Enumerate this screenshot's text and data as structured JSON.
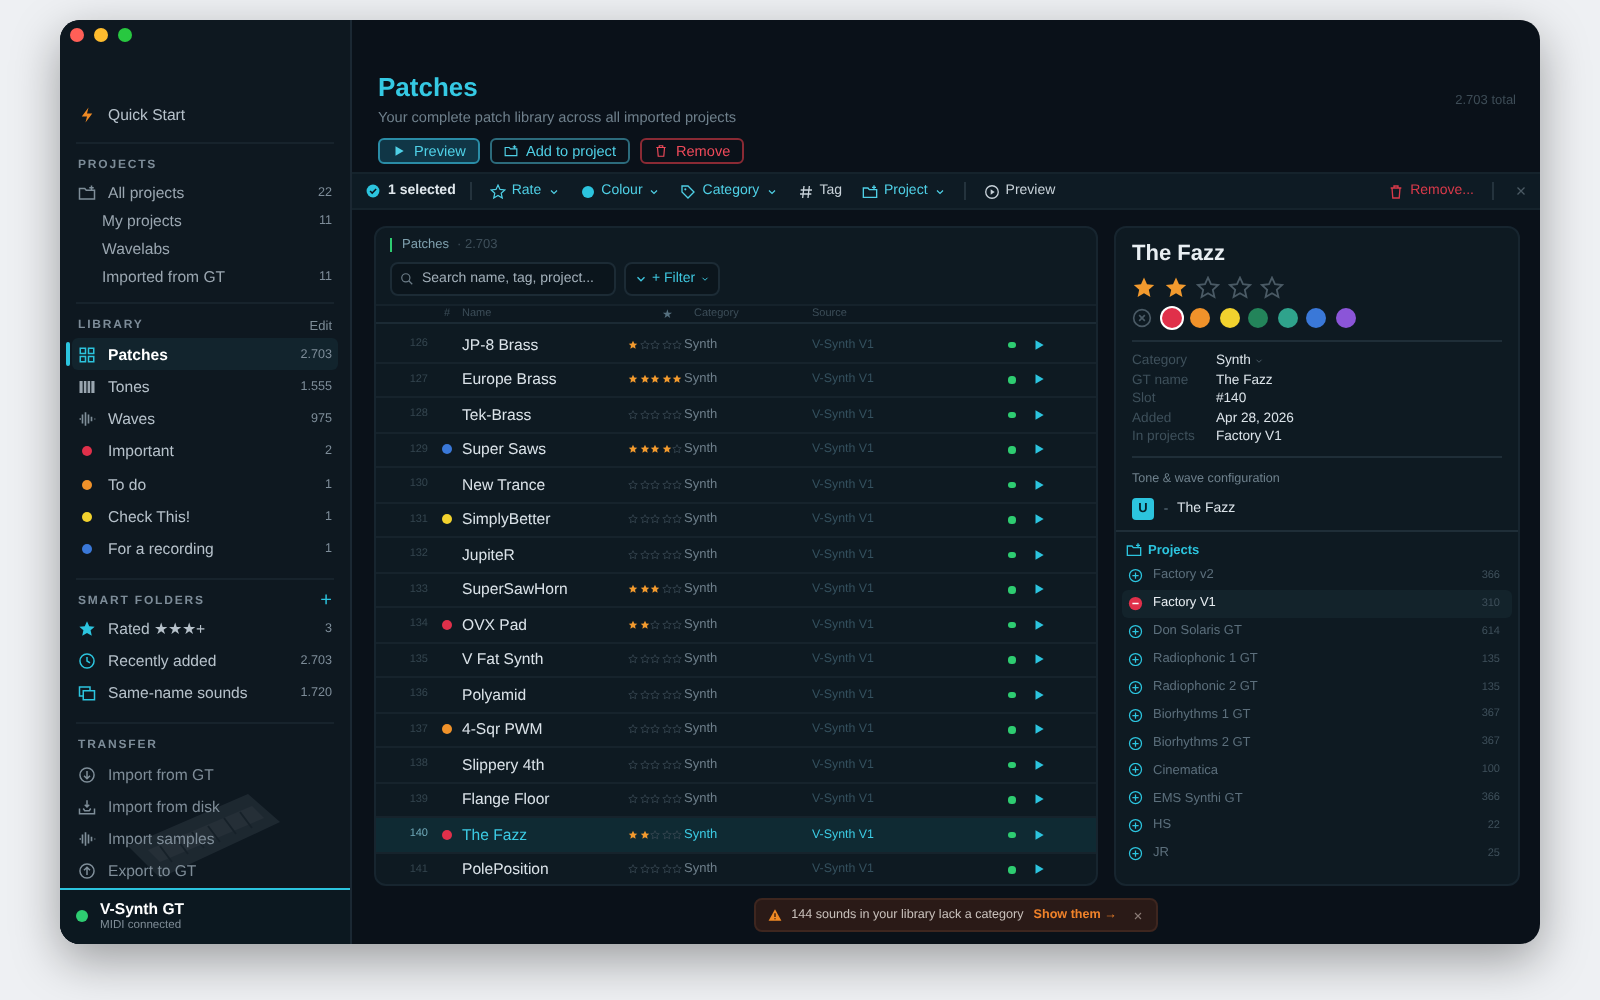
{
  "sidebar": {
    "quick_start": {
      "label": "Quick Start",
      "kind": "quick-start",
      "selected": false
    },
    "sections": [
      {
        "title": "PROJECTS",
        "items": [
          {
            "label": "All projects",
            "count": "22",
            "kind": "folder",
            "selected": false
          },
          {
            "label": "My projects",
            "count": "11",
            "kind": "sub",
            "selected": false
          },
          {
            "label": "Wavelabs",
            "kind": "sub",
            "selected": false
          },
          {
            "label": "Imported from GT",
            "count": "11",
            "kind": "sub",
            "selected": false
          }
        ]
      },
      {
        "title": "LIBRARY",
        "action": "Edit",
        "items": [
          {
            "label": "Patches",
            "count": "2.703",
            "kind": "patches",
            "selected": true
          },
          {
            "label": "Tones",
            "count": "1.555",
            "kind": "tones",
            "selected": false
          },
          {
            "label": "Waves",
            "count": "975",
            "kind": "waves",
            "selected": false
          },
          {
            "label": "Important",
            "count": "2",
            "kind": "tag",
            "color": "#e0304a",
            "selected": false
          },
          {
            "label": "To do",
            "count": "1",
            "kind": "tag",
            "color": "#f0922a",
            "selected": false
          },
          {
            "label": "Check This!",
            "count": "1",
            "kind": "tag",
            "color": "#f2d22e",
            "selected": false
          },
          {
            "label": "For a recording",
            "count": "1",
            "kind": "tag",
            "color": "#3a78d8",
            "selected": false
          }
        ]
      },
      {
        "title": "SMART FOLDERS",
        "action": "+",
        "items": [
          {
            "label": "Rated ★★★+",
            "count": "3",
            "kind": "rated",
            "selected": false
          },
          {
            "label": "Recently added",
            "count": "2.703",
            "kind": "recent",
            "selected": false
          },
          {
            "label": "Same-name sounds",
            "count": "1.720",
            "kind": "duplicates",
            "selected": false
          }
        ]
      },
      {
        "title": "TRANSFER",
        "items": [
          {
            "label": "Import from GT",
            "kind": "import-gt",
            "selected": false
          },
          {
            "label": "Import from disk",
            "kind": "import-disk",
            "selected": false
          },
          {
            "label": "Import samples",
            "kind": "import-samples",
            "selected": false
          },
          {
            "label": "Export to GT",
            "kind": "export",
            "selected": false
          }
        ]
      }
    ],
    "device": {
      "name": "V-Synth GT",
      "status": "MIDI connected",
      "connected": true
    }
  },
  "header": {
    "title": "Patches",
    "subtitle": "Your complete patch library across all imported projects",
    "total": "2.703 total",
    "buttons": [
      {
        "label": "Preview",
        "kind": "primary"
      },
      {
        "label": "Add to project",
        "kind": "secondary"
      },
      {
        "label": "Remove",
        "kind": "danger"
      }
    ]
  },
  "toolbar": {
    "selection": "1 selected",
    "actions": [
      {
        "label": "Rate",
        "kind": "rate",
        "dropdown": true
      },
      {
        "label": "Colour",
        "kind": "colour",
        "dropdown": true
      },
      {
        "label": "Category",
        "kind": "category",
        "dropdown": true
      },
      {
        "label": "Tag",
        "kind": "tag",
        "dropdown": false
      },
      {
        "label": "Project",
        "kind": "project",
        "dropdown": true
      },
      {
        "label": "Preview",
        "kind": "preview",
        "dropdown": false
      }
    ],
    "remove": "Remove..."
  },
  "table": {
    "title": "Patches",
    "count": "· 2.703",
    "search": {
      "placeholder": "Search name, tag, project..."
    },
    "filter": "+ Filter",
    "columns": [
      "#",
      "Name",
      "★",
      "Category",
      "Source"
    ],
    "rows": [
      {
        "number": "126",
        "name": "JP-8 Brass",
        "stars": 1,
        "category": "Synth",
        "source": "V-Synth V1",
        "synced": true,
        "selected": false
      },
      {
        "number": "127",
        "name": "Europe Brass",
        "stars": 5,
        "category": "Synth",
        "source": "V-Synth V1",
        "synced": true,
        "selected": false
      },
      {
        "number": "128",
        "name": "Tek-Brass",
        "stars": 0,
        "category": "Synth",
        "source": "V-Synth V1",
        "synced": true,
        "selected": false
      },
      {
        "number": "129",
        "name": "Super Saws",
        "stars": 4,
        "color": "#3a78d8",
        "category": "Synth",
        "source": "V-Synth V1",
        "synced": true,
        "selected": false
      },
      {
        "number": "130",
        "name": "New Trance",
        "stars": 0,
        "category": "Synth",
        "source": "V-Synth V1",
        "synced": true,
        "selected": false
      },
      {
        "number": "131",
        "name": "SimplyBetter",
        "stars": 0,
        "color": "#f2d22e",
        "category": "Synth",
        "source": "V-Synth V1",
        "synced": true,
        "selected": false
      },
      {
        "number": "132",
        "name": "JupiteR",
        "stars": 0,
        "category": "Synth",
        "source": "V-Synth V1",
        "synced": true,
        "selected": false
      },
      {
        "number": "133",
        "name": "SuperSawHorn",
        "stars": 3,
        "category": "Synth",
        "source": "V-Synth V1",
        "synced": true,
        "selected": false
      },
      {
        "number": "134",
        "name": "OVX Pad",
        "stars": 2,
        "color": "#e0304a",
        "category": "Synth",
        "source": "V-Synth V1",
        "synced": true,
        "selected": false
      },
      {
        "number": "135",
        "name": "V Fat Synth",
        "stars": 0,
        "category": "Synth",
        "source": "V-Synth V1",
        "synced": true,
        "selected": false
      },
      {
        "number": "136",
        "name": "Polyamid",
        "stars": 0,
        "category": "Synth",
        "source": "V-Synth V1",
        "synced": true,
        "selected": false
      },
      {
        "number": "137",
        "name": "4-Sqr PWM",
        "stars": 0,
        "color": "#f0922a",
        "category": "Synth",
        "source": "V-Synth V1",
        "synced": true,
        "selected": false
      },
      {
        "number": "138",
        "name": "Slippery 4th",
        "stars": 0,
        "category": "Synth",
        "source": "V-Synth V1",
        "synced": true,
        "selected": false
      },
      {
        "number": "139",
        "name": "Flange Floor",
        "stars": 0,
        "category": "Synth",
        "source": "V-Synth V1",
        "synced": true,
        "selected": false
      },
      {
        "number": "140",
        "name": "The Fazz",
        "stars": 2,
        "color": "#e0304a",
        "category": "Synth",
        "source": "V-Synth V1",
        "synced": true,
        "selected": true
      },
      {
        "number": "141",
        "name": "PolePosition",
        "stars": 0,
        "category": "Synth",
        "source": "V-Synth V1",
        "synced": true,
        "selected": false
      }
    ]
  },
  "detail": {
    "title": "The Fazz",
    "stars": 2,
    "swatches": [
      {
        "color": "#e0304a",
        "selected": true
      },
      {
        "color": "#f0922a",
        "selected": false
      },
      {
        "color": "#f2d22e",
        "selected": false
      },
      {
        "color": "#23845a",
        "selected": false
      },
      {
        "color": "#2fa38c",
        "selected": false
      },
      {
        "color": "#3a78d8",
        "selected": false
      },
      {
        "color": "#8b55d8",
        "selected": false
      }
    ],
    "properties": [
      {
        "label": "Category",
        "value": "Synth",
        "dropdown": true
      },
      {
        "label": "GT name",
        "value": "The Fazz",
        "dropdown": false
      },
      {
        "label": "Slot",
        "value": "#140",
        "dropdown": false
      },
      {
        "label": "Added",
        "value": "Apr 28, 2026",
        "dropdown": false
      },
      {
        "label": "In projects",
        "value": "Factory V1",
        "dropdown": false
      }
    ],
    "tone_section": "Tone & wave configuration",
    "tone": {
      "badge": "U",
      "name": "The Fazz"
    },
    "projects_title": "Projects",
    "projects": [
      {
        "name": "Factory v2",
        "count": "366",
        "included": false
      },
      {
        "name": "Factory V1",
        "count": "310",
        "included": true
      },
      {
        "name": "Don Solaris GT",
        "count": "614",
        "included": false
      },
      {
        "name": "Radiophonic 1 GT",
        "count": "135",
        "included": false
      },
      {
        "name": "Radiophonic 2 GT",
        "count": "135",
        "included": false
      },
      {
        "name": "Biorhythms 1 GT",
        "count": "367",
        "included": false
      },
      {
        "name": "Biorhythms 2 GT",
        "count": "367",
        "included": false
      },
      {
        "name": "Cinematica",
        "count": "100",
        "included": false
      },
      {
        "name": "EMS Synthi GT",
        "count": "366",
        "included": false
      },
      {
        "name": "HS",
        "count": "22",
        "included": false
      },
      {
        "name": "JR",
        "count": "25",
        "included": false
      }
    ]
  },
  "notice": {
    "message": "144 sounds in your library lack a category",
    "action": "Show them →"
  }
}
